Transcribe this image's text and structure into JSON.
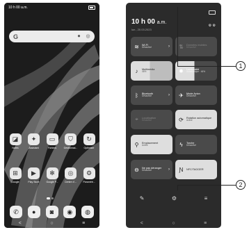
{
  "left_phone": {
    "status_time": "10 h 00 a.m.",
    "search_logo": "G",
    "search_icons": [
      "mic-icon",
      "lens-icon"
    ],
    "row1": [
      {
        "label": "Notes",
        "icon": "notes-icon",
        "glyph": "◪"
      },
      {
        "label": "Assistant",
        "icon": "assistant-icon",
        "glyph": "✦"
      },
      {
        "label": "Fichiers",
        "icon": "files-icon",
        "glyph": "▭"
      },
      {
        "label": "Gestionnai...",
        "icon": "shield-icon",
        "glyph": "⛉"
      },
      {
        "label": "Optimiser",
        "icon": "optimize-icon",
        "glyph": "↻"
      }
    ],
    "row2": [
      {
        "label": "Google",
        "icon": "google-apps-icon",
        "glyph": "⊞"
      },
      {
        "label": "Play Store",
        "icon": "play-store-icon",
        "glyph": "▶"
      },
      {
        "label": "Google P...",
        "icon": "google-photos-icon",
        "glyph": "✻"
      },
      {
        "label": "Centre d'...",
        "icon": "game-center-icon",
        "glyph": "◎"
      },
      {
        "label": "Paramètr...",
        "icon": "settings-icon",
        "glyph": "⚙"
      }
    ],
    "dock": [
      {
        "icon": "phone-icon",
        "glyph": "✆"
      },
      {
        "icon": "contacts-icon",
        "glyph": "●"
      },
      {
        "icon": "messages-icon",
        "glyph": "◙"
      },
      {
        "icon": "chrome-icon",
        "glyph": "◉"
      },
      {
        "icon": "camera-icon",
        "glyph": "◍"
      }
    ],
    "nav": [
      "<",
      "○",
      "≡"
    ]
  },
  "right_phone": {
    "time": "10 h 00",
    "time_suffix": "a.m.",
    "date": "lun., 20.03.2023",
    "top_icons": "⚙ ⚙",
    "tiles": [
      {
        "name": "Wi-Fi",
        "state": "Désactivé",
        "icon": "wifi-icon",
        "glyph": "≋",
        "style": "dark",
        "arrow": true
      },
      {
        "name": "Données mobiles",
        "state": "Désactivé",
        "icon": "data-icon",
        "glyph": "⇅",
        "style": "dim",
        "arrow": false
      },
      {
        "name": "Multimédia",
        "state": "46%",
        "icon": "music-icon",
        "glyph": "♪",
        "style": "light",
        "arrow": false,
        "level": 0.46
      },
      {
        "name": "Luminosité",
        "state": "Automatique · 46%",
        "icon": "brightness-icon",
        "glyph": "✹",
        "style": "half",
        "arrow": false,
        "level": 0.46
      },
      {
        "name": "Bluetooth",
        "state": "Désactivé",
        "icon": "bluetooth-icon",
        "glyph": "ᛒ",
        "style": "dark",
        "arrow": true
      },
      {
        "name": "Mode Avion",
        "state": "Désactivé",
        "icon": "airplane-icon",
        "glyph": "✈",
        "style": "dark",
        "arrow": false
      },
      {
        "name": "Localisation",
        "state": "Désactivé",
        "icon": "location-off-icon",
        "glyph": "⌖",
        "style": "dim",
        "arrow": false
      },
      {
        "name": "Rotation automatique",
        "state": "Activé",
        "icon": "rotate-icon",
        "glyph": "⟳",
        "style": "light",
        "arrow": false
      },
      {
        "name": "Emplacement",
        "state": "Activé",
        "icon": "pin-icon",
        "glyph": "⚲",
        "style": "light",
        "arrow": false
      },
      {
        "name": "Torche",
        "state": "Désactivé",
        "icon": "torch-icon",
        "glyph": "ϟ",
        "style": "dark",
        "arrow": false
      },
      {
        "name": "Ne pas déranger",
        "state": "Désactivé",
        "icon": "dnd-icon",
        "glyph": "⊖",
        "style": "dark",
        "arrow": true
      },
      {
        "name": "NFC/TAGGER",
        "state": "",
        "icon": "nfc-icon",
        "glyph": "Ɲ",
        "style": "light",
        "arrow": false
      }
    ],
    "bottom": [
      {
        "icon": "edit-icon",
        "glyph": "✎"
      },
      {
        "icon": "settings-icon",
        "glyph": "⚙"
      },
      {
        "icon": "manage-icon",
        "glyph": "≡"
      }
    ],
    "nav": [
      "<",
      "○",
      "≡"
    ]
  },
  "callouts": [
    "1",
    "2"
  ]
}
